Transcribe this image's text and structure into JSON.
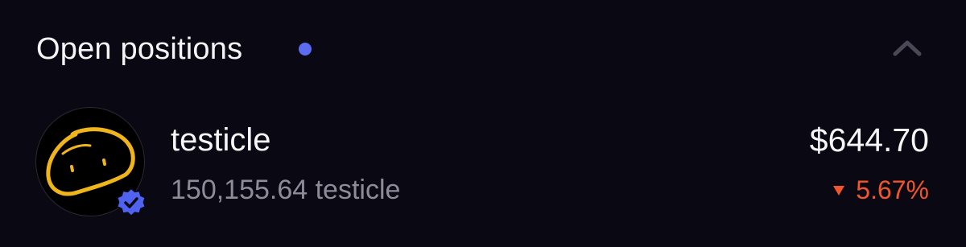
{
  "section": {
    "title": "Open positions",
    "status_dot_color": "#5b6cf2",
    "collapse_icon": "chevron-up-icon"
  },
  "position": {
    "name": "testicle",
    "balance": "150,155.64 testicle",
    "value": "$644.70",
    "change": "5.67%",
    "change_direction": "down",
    "change_color": "#f0552d",
    "avatar_icon": "hand-drawn-yellow-face",
    "avatar_stroke_color": "#f1b51c",
    "verified": true,
    "verified_badge_color": "#4f63f0"
  }
}
